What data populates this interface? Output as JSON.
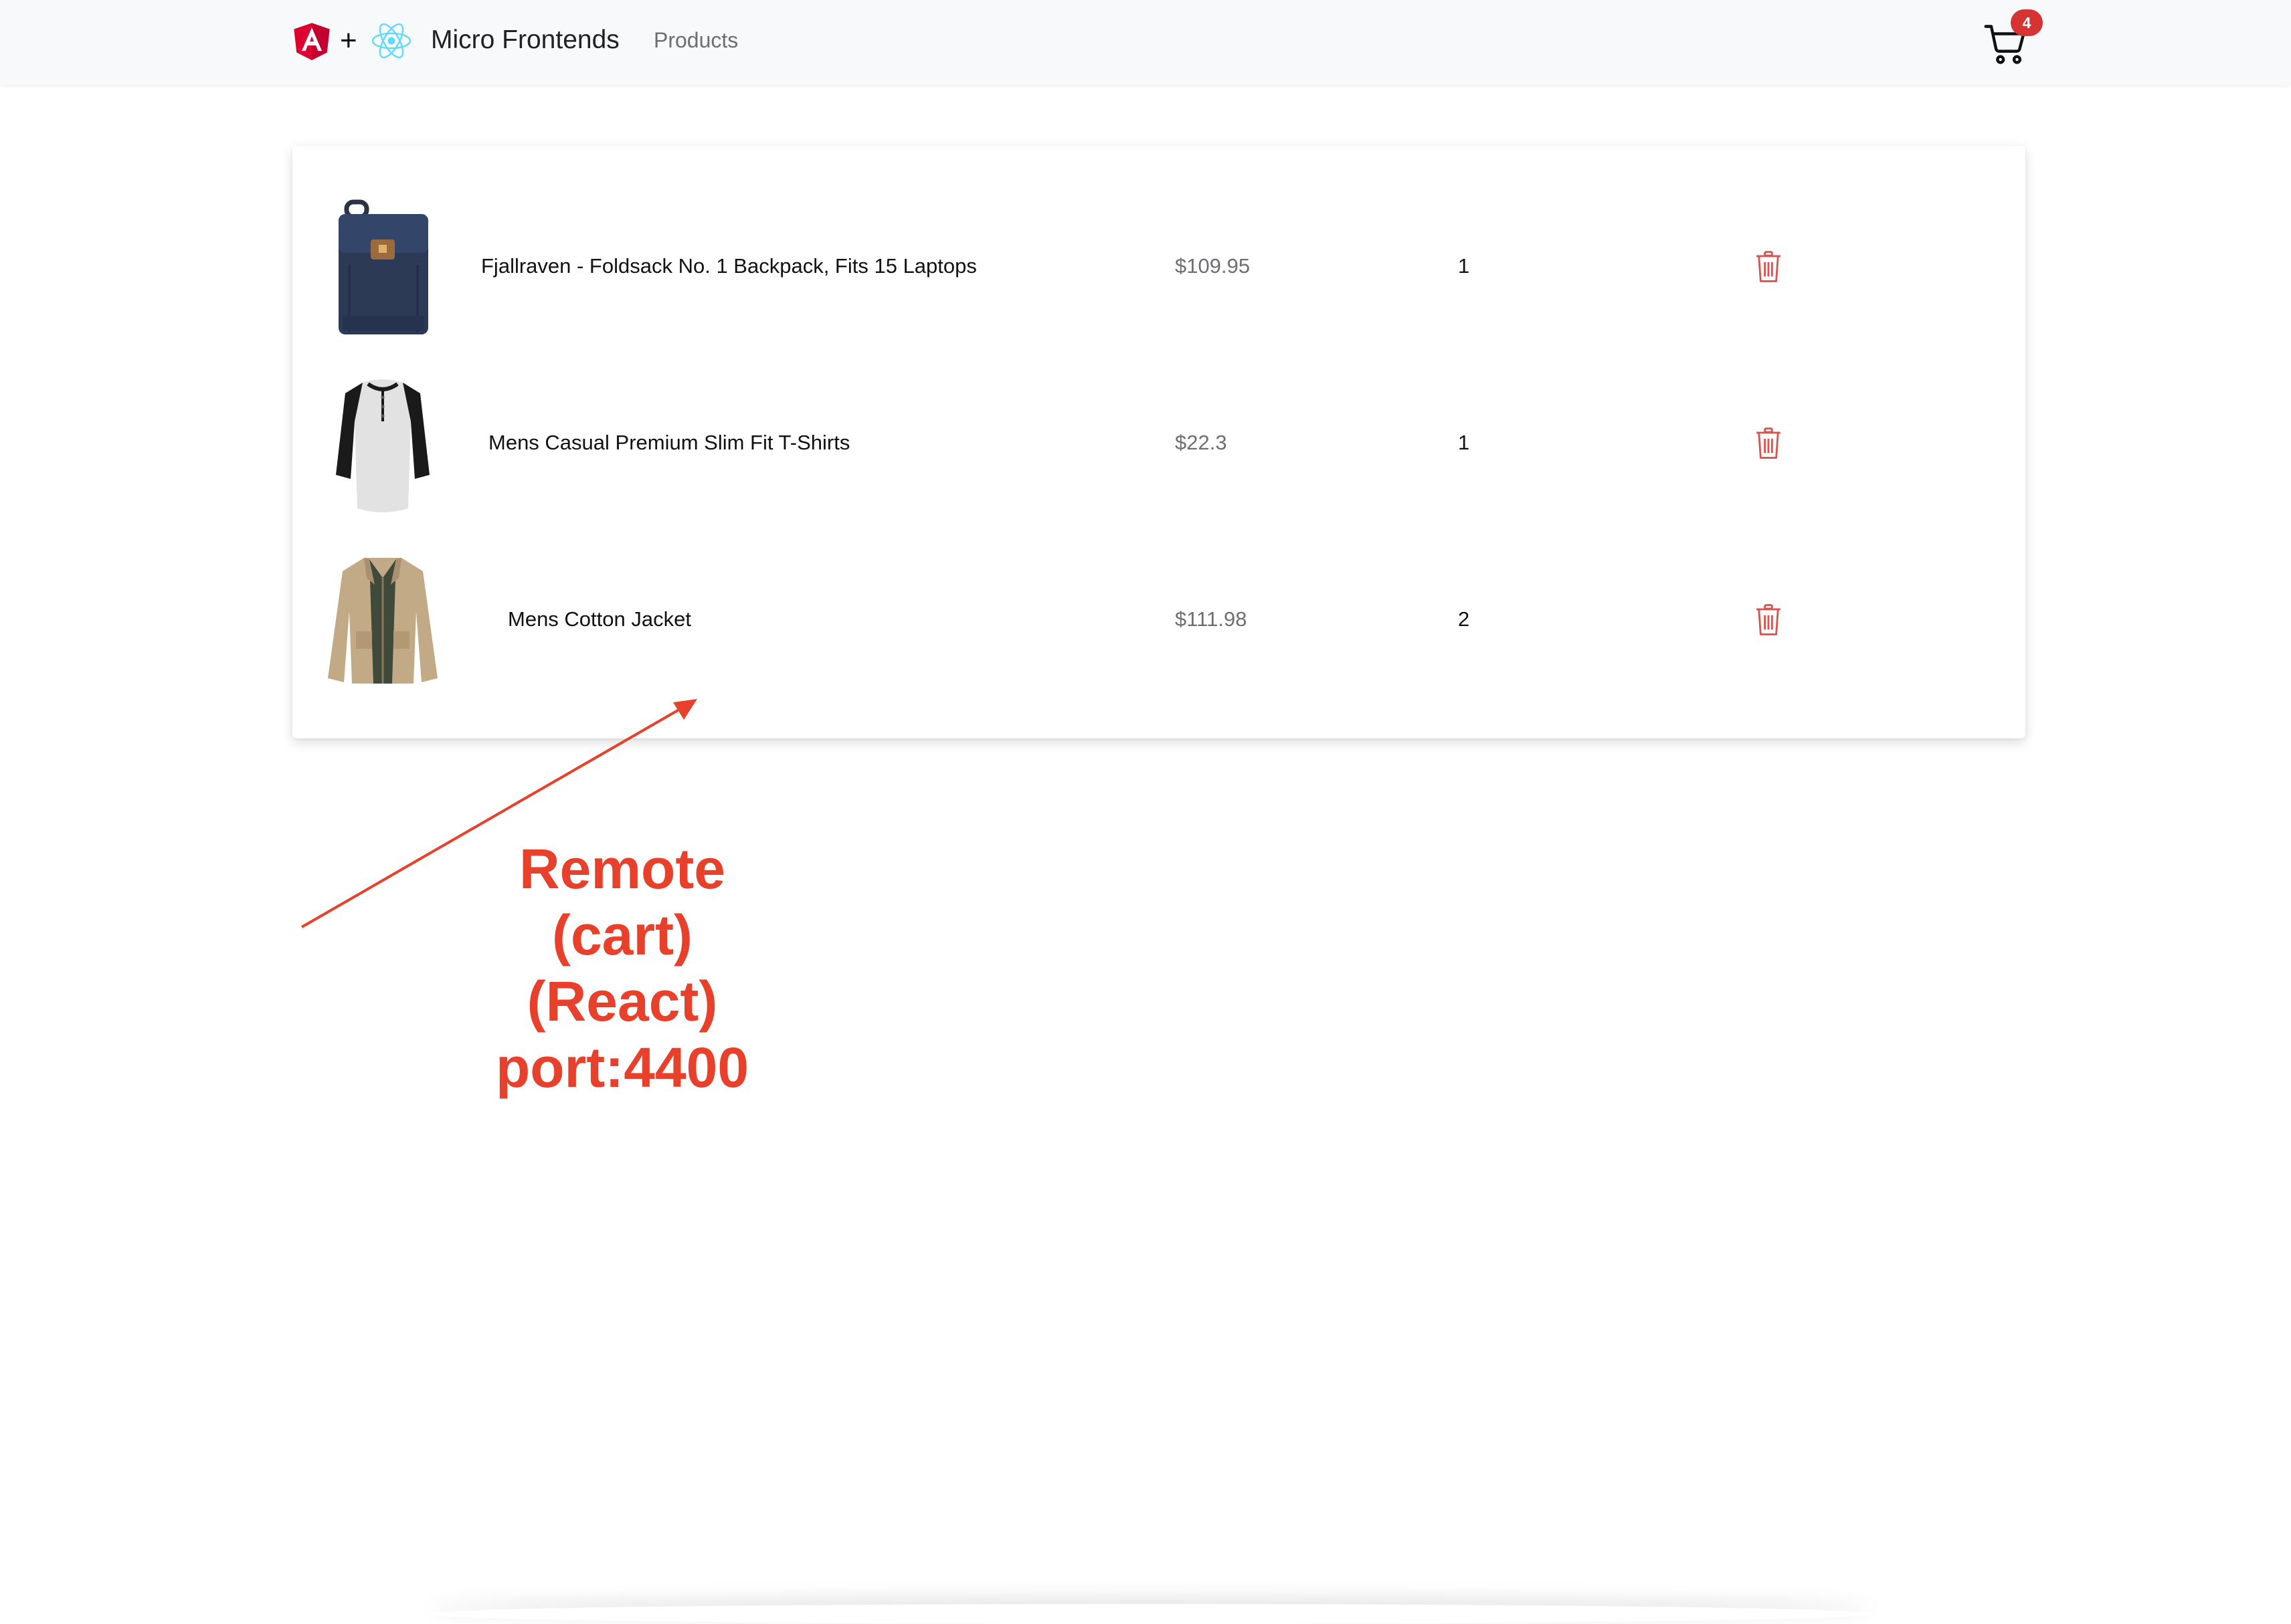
{
  "navbar": {
    "brand_plus": "+",
    "brand_title": "Micro Frontends",
    "nav_products": "Products",
    "cart_count": "4",
    "colors": {
      "angular_red": "#dd0031",
      "react_cyan": "#61dafb",
      "badge_red": "#d63333",
      "navbar_bg": "#f8f9fa"
    },
    "icons": [
      "angular-logo-icon",
      "react-logo-icon",
      "cart-icon"
    ]
  },
  "cart": {
    "items": [
      {
        "name": "Fjallraven - Foldsack No. 1 Backpack, Fits 15 Laptops",
        "price": "$109.95",
        "quantity": "1",
        "image": "backpack-image",
        "delete_icon": "trash-icon"
      },
      {
        "name": "Mens Casual Premium Slim Fit T-Shirts",
        "price": "$22.3",
        "quantity": "1",
        "image": "tshirt-image",
        "delete_icon": "trash-icon"
      },
      {
        "name": "Mens Cotton Jacket",
        "price": "$111.98",
        "quantity": "2",
        "image": "jacket-image",
        "delete_icon": "trash-icon"
      }
    ],
    "colors": {
      "delete_red": "#d9534f",
      "price_gray": "#6c6f72"
    }
  },
  "annotation": {
    "lines": [
      "Remote",
      "(cart)",
      "(React)",
      "port:4400"
    ],
    "color": "#e8402a"
  }
}
